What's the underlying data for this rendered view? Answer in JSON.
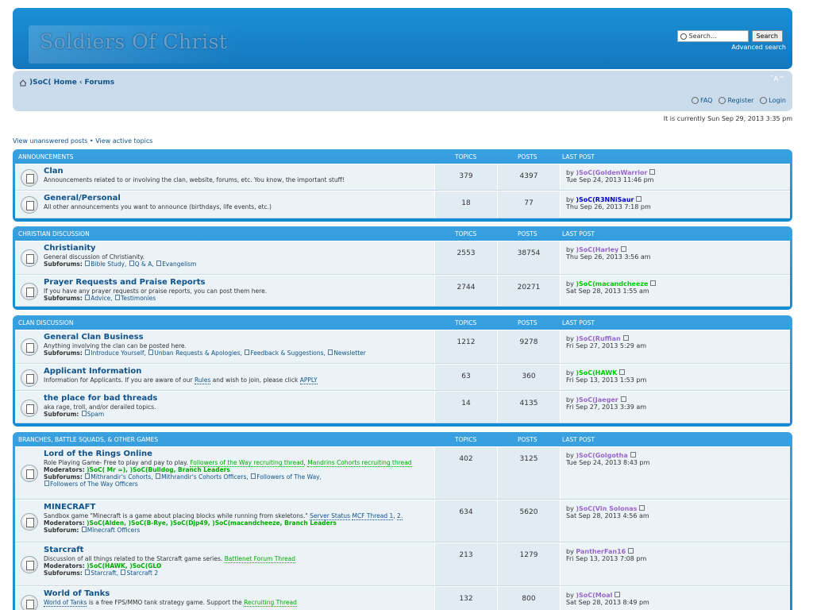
{
  "site": {
    "logo_text": "Soldiers Of Christ",
    "search_placeholder": "Search…",
    "search_button": "Search",
    "advanced_search": "Advanced search"
  },
  "nav": {
    "home": ")SoC( Home",
    "sep": "‹",
    "forums": "Forums",
    "fontsize": "ˇA^",
    "faq": "FAQ",
    "register": "Register",
    "login": "Login"
  },
  "current_time": "It is currently Sun Sep 29, 2013 3:35 pm",
  "quick": {
    "unanswered": "View unanswered posts",
    "sep": " • ",
    "active": "View active topics"
  },
  "cols": {
    "topics": "TOPICS",
    "posts": "POSTS",
    "last": "LAST POST"
  },
  "categories": [
    {
      "name": "ANNOUNCEMENTS"
    },
    {
      "name": "CHRISTIAN DISCUSSION"
    },
    {
      "name": "CLAN DISCUSSION"
    },
    {
      "name": "BRANCHES, BATTLE SQUADS, & OTHER GAMES"
    }
  ],
  "forums": {
    "clan": {
      "name": "Clan",
      "desc": "Announcements related to or involving the clan, website, forums, etc. You know, the important stuff!",
      "topics": "379",
      "posts": "4397",
      "by": "by",
      "user": ")SoC(GoldenWarrior",
      "date": "Tue Sep 24, 2013 11:46 pm",
      "user_color": "#9966cc"
    },
    "general": {
      "name": "General/Personal",
      "desc": "All other announcements you want to announce (birthdays, life events, etc.)",
      "topics": "18",
      "posts": "77",
      "by": "by",
      "user": ")SoC(R3NNiSaur",
      "date": "Thu Sep 26, 2013 7:18 pm",
      "user_color": "#0000cc"
    },
    "christianity": {
      "name": "Christianity",
      "desc": "General discussion of Christianity.",
      "sub_label": "Subforums:",
      "subs": [
        "Bible Study,",
        "Q & A,",
        "Evangelism"
      ],
      "topics": "2553",
      "posts": "38754",
      "by": "by",
      "user": ")SoC(Harley",
      "date": "Thu Sep 26, 2013 3:56 am",
      "user_color": "#9966cc"
    },
    "prayer": {
      "name": "Prayer Requests and Praise Reports",
      "desc": "If you have any prayer requests or praise reports, you can post them here.",
      "sub_label": "Subforums:",
      "subs": [
        "Advice,",
        "Testimonies"
      ],
      "topics": "2744",
      "posts": "20271",
      "by": "by",
      "user": ")SoC(macandcheeze",
      "date": "Sat Sep 28, 2013 1:55 am",
      "user_color": "#00cc00"
    },
    "business": {
      "name": "General Clan Business",
      "desc": "Anything involving the clan can be posted here.",
      "sub_label": "Subforums:",
      "subs": [
        "Introduce Yourself,",
        "Unban Requests & Apologies,",
        "Feedback & Suggestions,",
        "Newsletter"
      ],
      "topics": "1212",
      "posts": "9278",
      "by": "by",
      "user": ")SoC(Ruffian",
      "date": "Fri Sep 27, 2013 5:29 am",
      "user_color": "#9966cc"
    },
    "applicant": {
      "name": "Applicant Information",
      "desc_a": "Information for Applicants. If you are aware of our",
      "rules": "Rules",
      "desc_b": "and wish to join, please click",
      "apply": "APPLY",
      "topics": "63",
      "posts": "360",
      "by": "by",
      "user": ")SoC(HAWK",
      "date": "Fri Sep 13, 2013 1:53 pm",
      "user_color": "#00cc00"
    },
    "bad": {
      "name": "the place for bad threads",
      "desc": "aka rage, troll, and/or derailed topics.",
      "sub_label": "Subforum:",
      "subs": [
        "Spam"
      ],
      "topics": "14",
      "posts": "4135",
      "by": "by",
      "user": ")SoC(Jaeger",
      "date": "Fri Sep 27, 2013 3:39 am",
      "user_color": "#9966cc"
    },
    "lotro": {
      "name": "Lord of the Rings Online",
      "desc": "Role Playing Game- Free to play and pay to play.",
      "link1": "Followers of the Way recruiting thread",
      "link2": "Mandrins Cohorts recruiting thread",
      "mods_label": "Moderators:",
      "mods": ")SoC( Mr =), )SoC(Bulldog, Branch Leaders",
      "sub_label": "Subforums:",
      "subs": [
        "Mithrandir's Cohorts,",
        "Mithrandir's Cohorts Officers,",
        "Followers of The Way,"
      ],
      "subs2": [
        "Followers of The Way Officers"
      ],
      "topics": "402",
      "posts": "3125",
      "by": "by",
      "user": ")SoC(Golgotha",
      "date": "Tue Sep 24, 2013 8:43 pm",
      "user_color": "#9966cc"
    },
    "minecraft": {
      "name": "MINECRAFT",
      "desc": "Sandbox game \"Minecraft is a game about placing blocks while running from skeletons.\"",
      "link1": "Server Status",
      "link2": "MCF Thread 1",
      "link3": "2.",
      "mods_label": "Moderators:",
      "mods": ")SoC(Alden, )SoC(B-Rye, )SoC(Djp49, )SoC(macandcheeze, Branch Leaders",
      "sub_label": "Subforum:",
      "subs": [
        "Minecraft Officers"
      ],
      "topics": "634",
      "posts": "5620",
      "by": "by",
      "user": ")SoC(Vin Solonas",
      "date": "Sat Sep 28, 2013 4:56 am",
      "user_color": "#9966cc"
    },
    "starcraft": {
      "name": "Starcraft",
      "desc": "Discussion of all things related to the Starcraft game series.",
      "link1": "Battlenet Forum Thread",
      "mods_label": "Moderators:",
      "mods": ")SoC(HAWK, )SoC(GLO",
      "sub_label": "Subforums:",
      "subs": [
        "Starcraft,",
        "Starcraft 2"
      ],
      "topics": "213",
      "posts": "1279",
      "by": "by",
      "user": "PantherFan16",
      "date": "Fri Sep 13, 2013 7:08 pm",
      "user_color": "#9966cc"
    },
    "wot": {
      "name": "World of Tanks",
      "desc_link": "World of Tanks",
      "desc": "is a free FPS/MMO tank strategy game. Support the",
      "link1": "Recruiting Thread",
      "topics": "132",
      "posts": "800",
      "by": "by",
      "user": ")SoC(Moal",
      "date": "Sat Sep 28, 2013 8:49 pm",
      "user_color": "#9966cc"
    }
  }
}
